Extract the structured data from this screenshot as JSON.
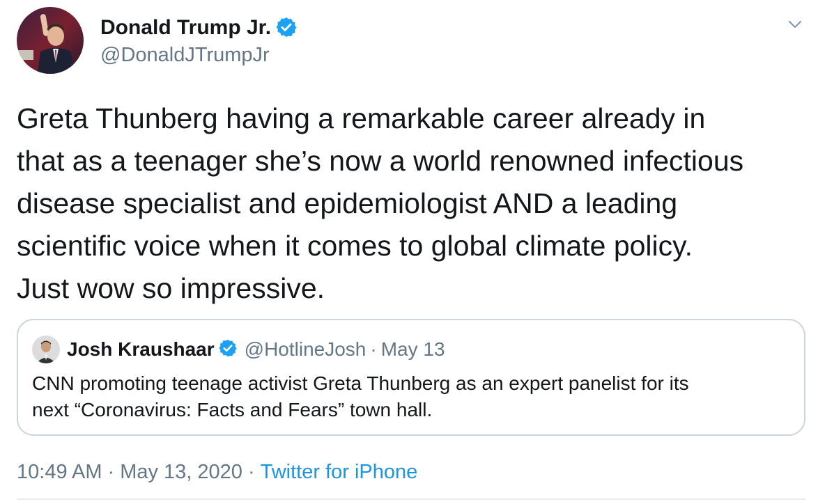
{
  "tweet": {
    "author": {
      "name": "Donald Trump Jr.",
      "handle": "@DonaldJTrumpJr",
      "verified": true
    },
    "text": "Greta Thunberg having a remarkable career already in\nthat as a teenager she’s now a world renowned infectious\ndisease specialist and epidemiologist AND a leading\nscientific voice when it comes to global climate policy.\nJust wow so impressive.",
    "quoted": {
      "name": "Josh Kraushaar",
      "handle": "@HotlineJosh",
      "separator": "·",
      "date": "May 13",
      "verified": true,
      "text": "CNN promoting teenage activist Greta Thunberg as an expert panelist for its\nnext “Coronavirus: Facts and Fears” town hall."
    },
    "meta": {
      "time": "10:49 AM",
      "separator": "·",
      "date": "May 13, 2020",
      "source": "Twitter for iPhone"
    }
  },
  "icons": {
    "verified": "verified-badge-icon",
    "caret": "chevron-down-icon"
  },
  "colors": {
    "accent": "#1da1f2",
    "link": "#1b95e0",
    "text_primary": "#14171a",
    "text_secondary": "#657786",
    "border": "#ccd6dd"
  }
}
